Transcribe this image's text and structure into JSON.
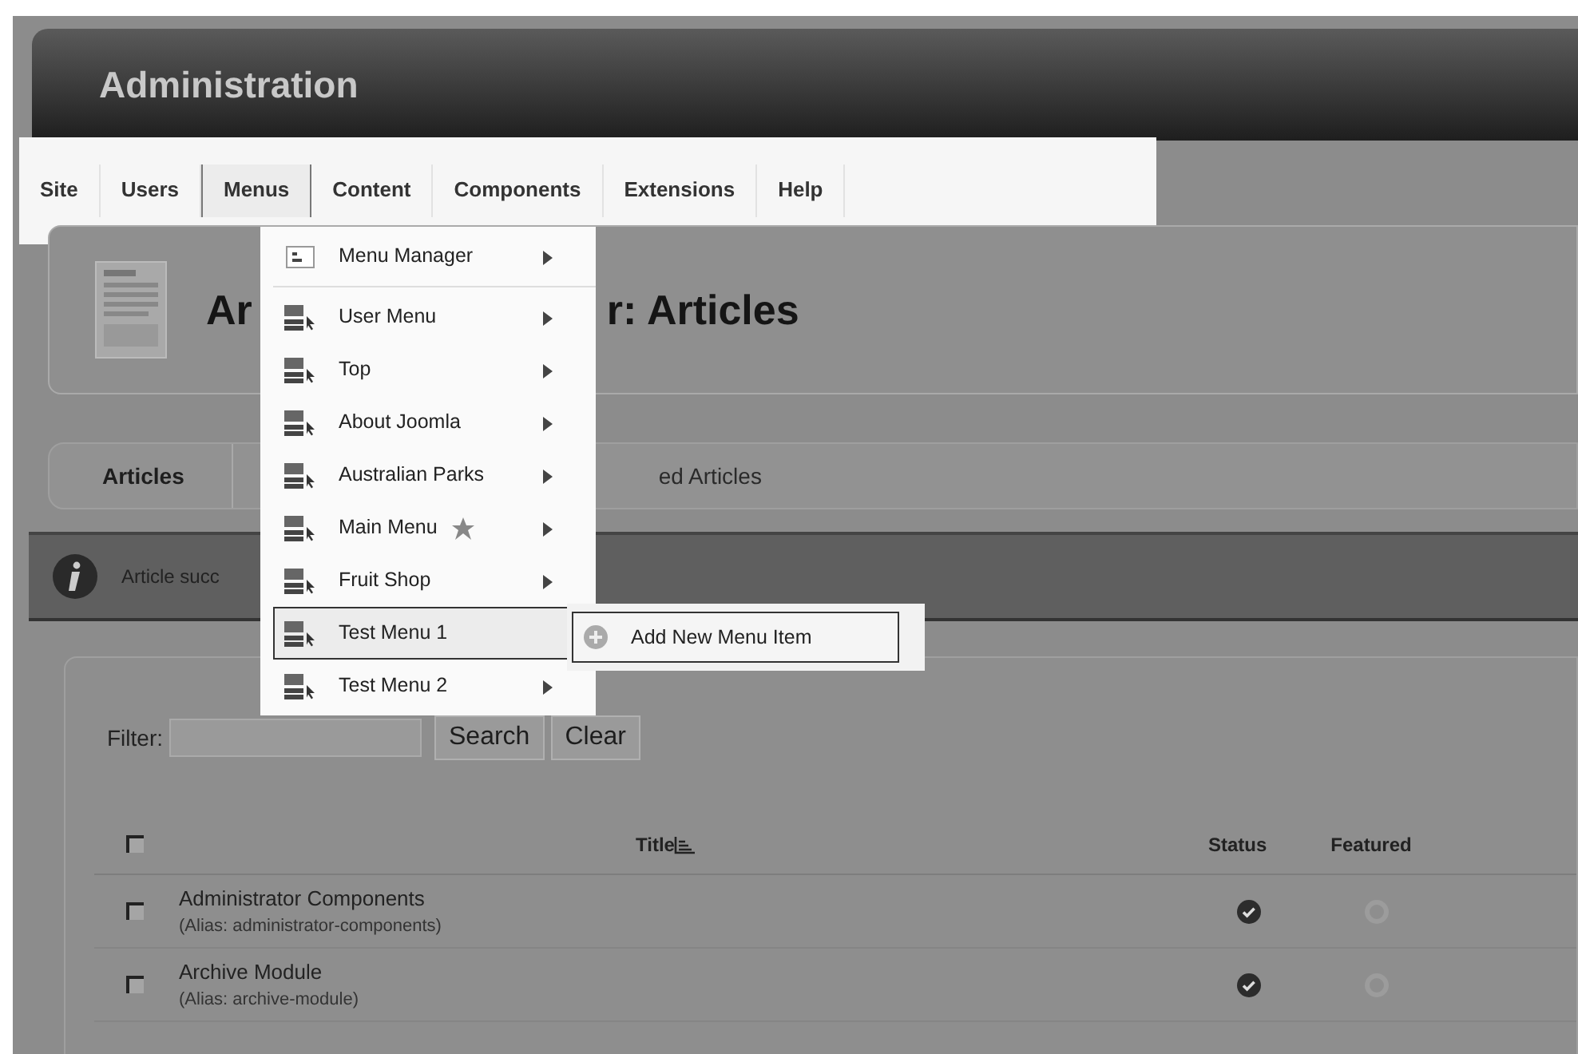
{
  "header": {
    "title": "Administration"
  },
  "menubar": [
    {
      "label": "Site",
      "selected": false
    },
    {
      "label": "Users",
      "selected": false
    },
    {
      "label": "Menus",
      "selected": true
    },
    {
      "label": "Content",
      "selected": false
    },
    {
      "label": "Components",
      "selected": false
    },
    {
      "label": "Extensions",
      "selected": false
    },
    {
      "label": "Help",
      "selected": false
    }
  ],
  "page": {
    "title_parts": [
      "Ar",
      "r: Articles"
    ],
    "tabs": [
      "Articles",
      "ed Articles"
    ],
    "message": "Article succ",
    "filter": {
      "label": "Filter:",
      "buttons": [
        "Search",
        "Clear"
      ]
    },
    "table": {
      "all_checked": false,
      "columns": [
        "Title",
        "Status",
        "Featured"
      ],
      "rows": [
        {
          "title": "Administrator Components",
          "alias": "(Alias: administrator-components)",
          "checked": false,
          "published": true,
          "featured": false
        },
        {
          "title": "Archive Module",
          "alias": "(Alias: archive-module)",
          "checked": false,
          "published": true,
          "featured": false
        }
      ]
    }
  },
  "dropdown": {
    "items": [
      {
        "label": "Menu Manager",
        "kind": "manager",
        "default": false,
        "expanded": false
      },
      {
        "label": "User Menu",
        "kind": "menu",
        "default": false,
        "expanded": false
      },
      {
        "label": "Top",
        "kind": "menu",
        "default": false,
        "expanded": false
      },
      {
        "label": "About Joomla",
        "kind": "menu",
        "default": false,
        "expanded": false
      },
      {
        "label": "Australian Parks",
        "kind": "menu",
        "default": false,
        "expanded": false
      },
      {
        "label": "Main Menu",
        "kind": "menu",
        "default": true,
        "expanded": false
      },
      {
        "label": "Fruit Shop",
        "kind": "menu",
        "default": false,
        "expanded": false
      },
      {
        "label": "Test Menu 1",
        "kind": "menu",
        "default": false,
        "expanded": true
      },
      {
        "label": "Test Menu 2",
        "kind": "menu",
        "default": false,
        "expanded": false
      }
    ],
    "submenu": [
      "Add New Menu Item"
    ]
  }
}
